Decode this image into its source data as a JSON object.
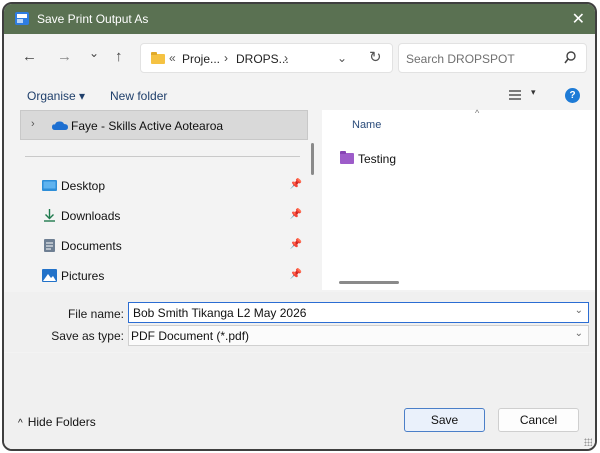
{
  "window": {
    "title": "Save Print Output As",
    "close_label": "✕"
  },
  "navigation": {
    "back": "←",
    "forward": "→",
    "recent": "⌄",
    "up": "↑",
    "breadcrumb_more": "«",
    "breadcrumb": [
      "Proje...",
      "DROPS..."
    ],
    "breadcrumb_separator": "›",
    "address_dropdown": "⌄",
    "refresh": "↻"
  },
  "search": {
    "placeholder": "Search DROPSPOT"
  },
  "command_bar": {
    "organise": "Organise ▾",
    "new_folder": "New folder",
    "help": "?",
    "view_menu": "▾"
  },
  "nav_pane": {
    "selected": {
      "label": "Faye - Skills Active Aotearoa",
      "expand": "›"
    },
    "quick_access": [
      {
        "label": "Desktop",
        "icon": "desktop-icon",
        "pin": "📌"
      },
      {
        "label": "Downloads",
        "icon": "download-icon",
        "pin": "📌"
      },
      {
        "label": "Documents",
        "icon": "documents-icon",
        "pin": "📌"
      },
      {
        "label": "Pictures",
        "icon": "pictures-icon",
        "pin": "📌"
      }
    ]
  },
  "file_list": {
    "column_name": "Name",
    "sort_indicator": "^",
    "items": [
      {
        "name": "Testing",
        "type": "folder"
      }
    ]
  },
  "form": {
    "file_name_label": "File name:",
    "file_name_value": "Bob Smith Tikanga L2 May 2026",
    "save_type_label": "Save as type:",
    "save_type_value": "PDF Document (*.pdf)",
    "dropdown_caret": "⌄"
  },
  "footer": {
    "hide_folders": "Hide Folders",
    "hide_folders_chevron": "^",
    "save": "Save",
    "cancel": "Cancel"
  },
  "colors": {
    "titlebar": "#5a7152",
    "accent": "#2b6dd3",
    "folder_selected": "#9d5cc9"
  }
}
